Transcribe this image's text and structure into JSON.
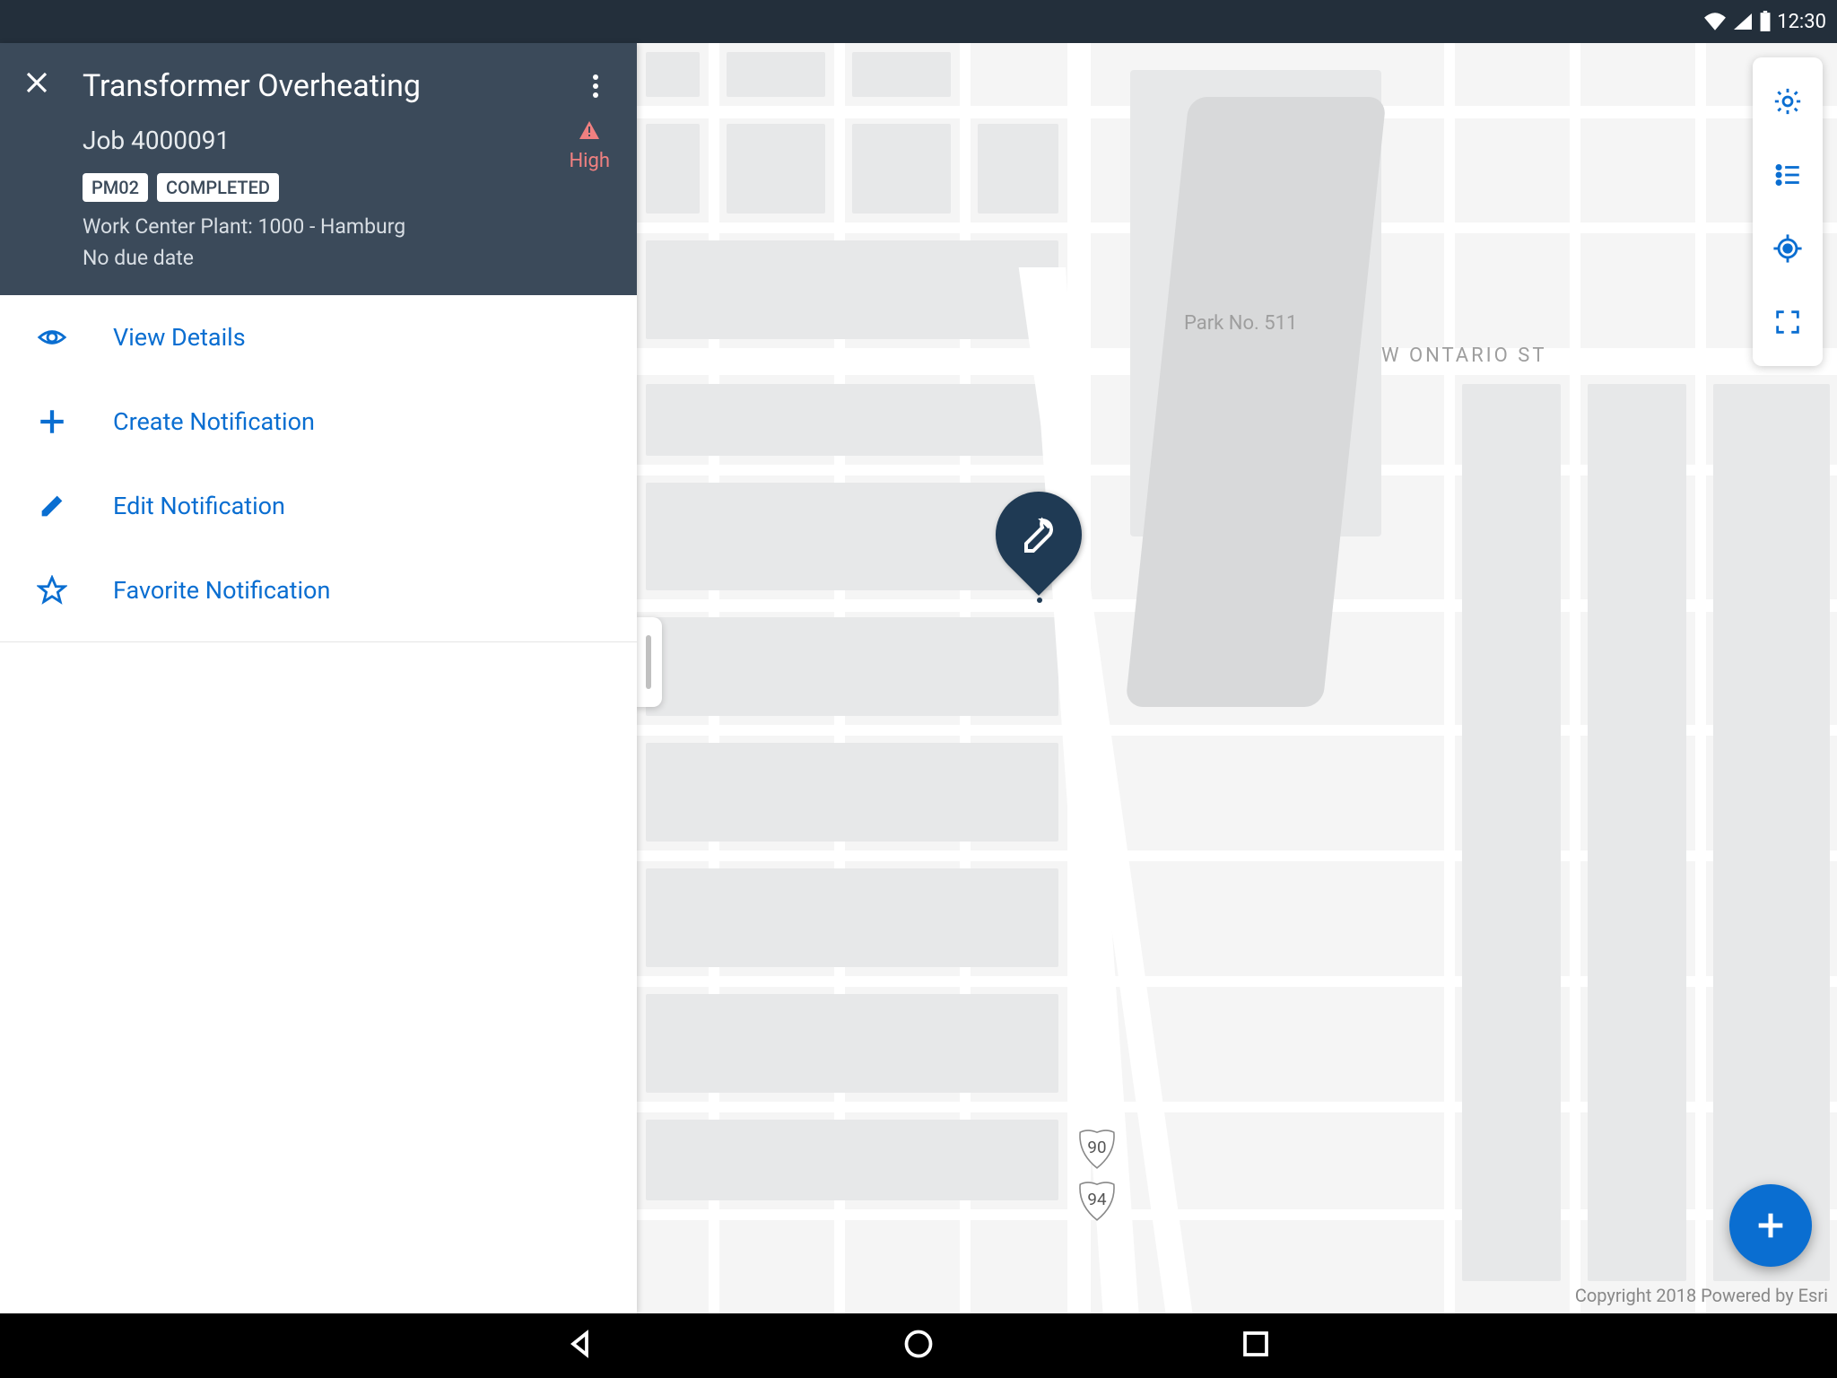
{
  "status": {
    "time": "12:30"
  },
  "header": {
    "title": "Transformer Overheating",
    "job_label": "Job 4000091",
    "priority": "High",
    "badges": [
      "PM02",
      "COMPLETED"
    ],
    "work_center": "Work Center Plant: 1000 - Hamburg",
    "due": "No due date"
  },
  "actions": [
    {
      "icon": "eye",
      "label": "View Details"
    },
    {
      "icon": "plus",
      "label": "Create Notification"
    },
    {
      "icon": "pencil",
      "label": "Edit Notification"
    },
    {
      "icon": "star",
      "label": "Favorite Notification"
    }
  ],
  "map": {
    "labels": {
      "park": "Park No. 511",
      "street": "W ONTARIO ST"
    },
    "shields": [
      "90",
      "94"
    ],
    "copyright": "Copyright 2018 Powered by Esri"
  },
  "map_toolbar": [
    "settings",
    "list",
    "locate",
    "expand"
  ],
  "fab_label": "+"
}
